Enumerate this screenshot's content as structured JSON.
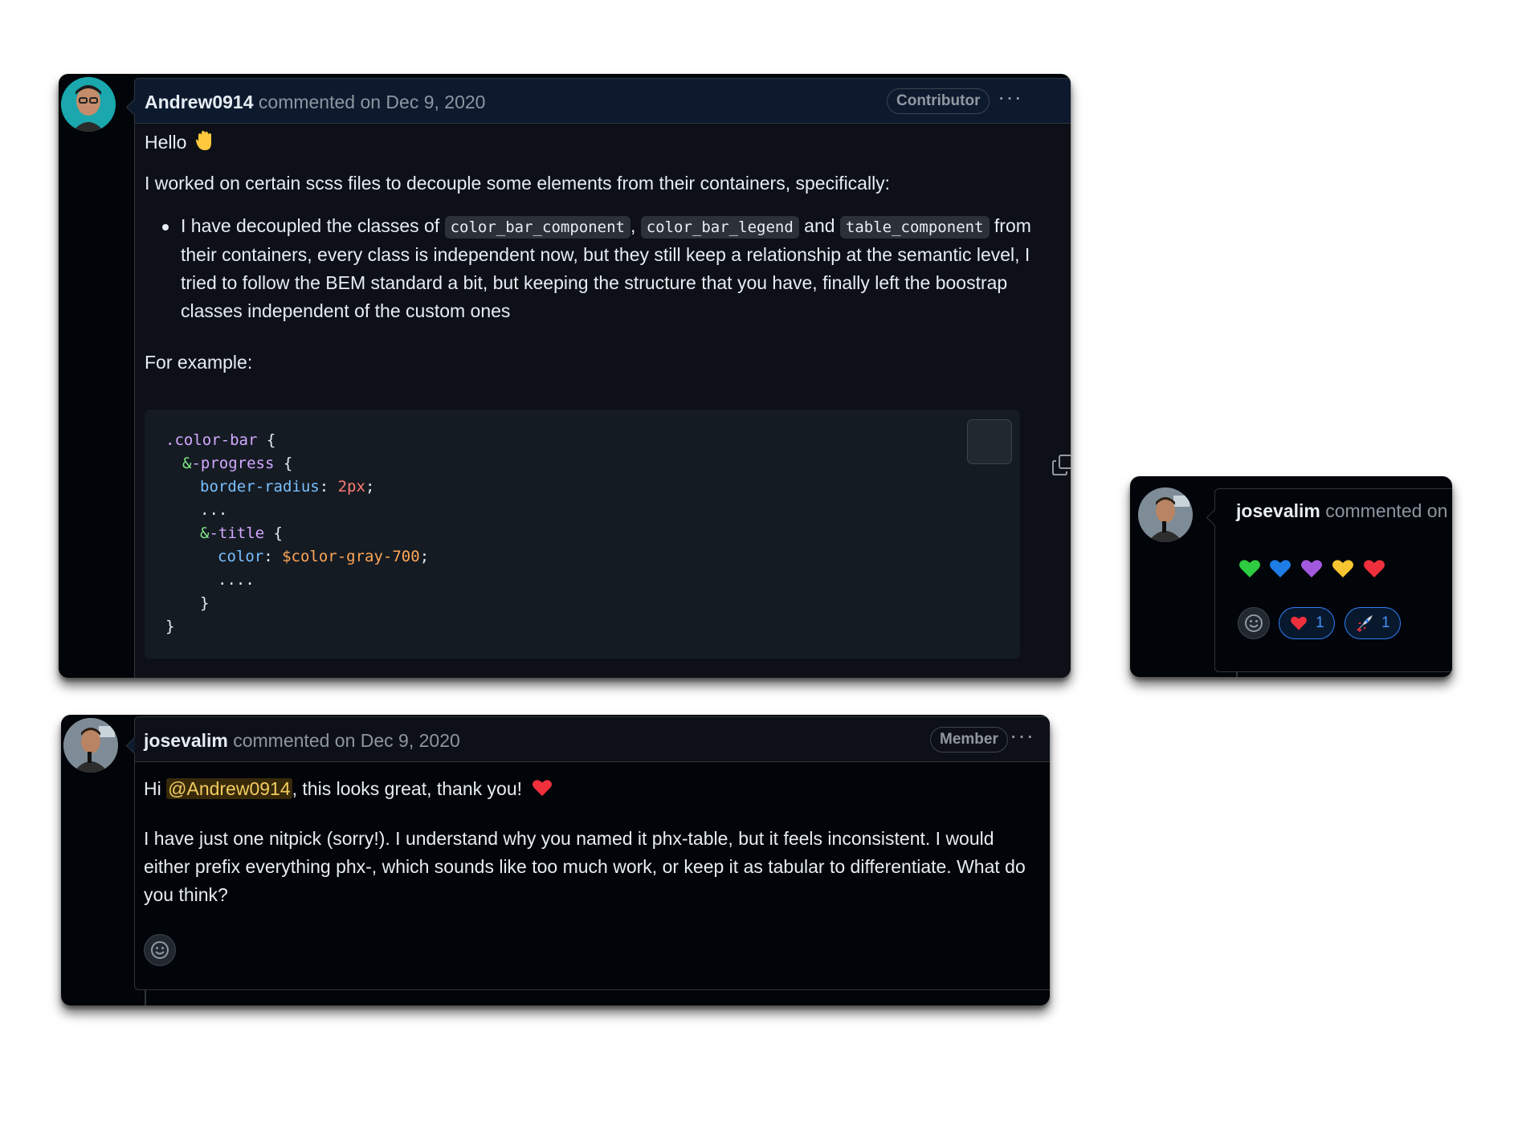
{
  "comment1": {
    "author": "Andrew0914",
    "meta": "commented on Dec 9, 2020",
    "badge": "Contributor",
    "greeting": "Hello",
    "intro": "I worked on certain scss files to decouple some elements from their containers, specifically:",
    "bullet_prefix": "I have decoupled the classes of",
    "code1": "color_bar_component",
    "code2": "color_bar_legend",
    "and": "and",
    "code3": "table_component",
    "from": "from",
    "bullet_line2": "their containers, every class is independent now, but they still keep a relationship at the semantic level, I",
    "bullet_line3": "tried to follow the BEM standard a bit, but keeping the structure that you have, finally left the boostrap",
    "bullet_line4": "classes independent of the custom ones",
    "example_label": "For example:",
    "code_lines": {
      "l1_sel": ".color-bar",
      "l1_rest": " {",
      "l2_amp": "&",
      "l2_sel": "-progress",
      "l2_rest": " {",
      "l3_prop": "border-radius",
      "l3_colon": ": ",
      "l3_num": "2px",
      "l3_end": ";",
      "l4": "...",
      "l5_amp": "&",
      "l5_sel": "-title",
      "l5_rest": " {",
      "l6_prop": "color",
      "l6_colon": ": ",
      "l6_var": "$color-gray-700",
      "l6_end": ";",
      "l7": "....",
      "l8": "}",
      "l9": "}"
    }
  },
  "comment2": {
    "author": "josevalim",
    "meta": "commented on Dec 9, 2020",
    "badge": "Member",
    "hi": "Hi",
    "mention": "@Andrew0914",
    "thanks": ", this looks great, thank you!",
    "p2_line1": "I have just one nitpick (sorry!). I understand why you named it phx-table, but it feels inconsistent. I would",
    "p2_line2": "either prefix everything phx-, which sounds like too much work, or keep it as tabular to differentiate. What do",
    "p2_line3": "you think?"
  },
  "comment3": {
    "author": "josevalim",
    "meta": "commented on",
    "reaction1_count": "1",
    "reaction2_count": "1"
  }
}
